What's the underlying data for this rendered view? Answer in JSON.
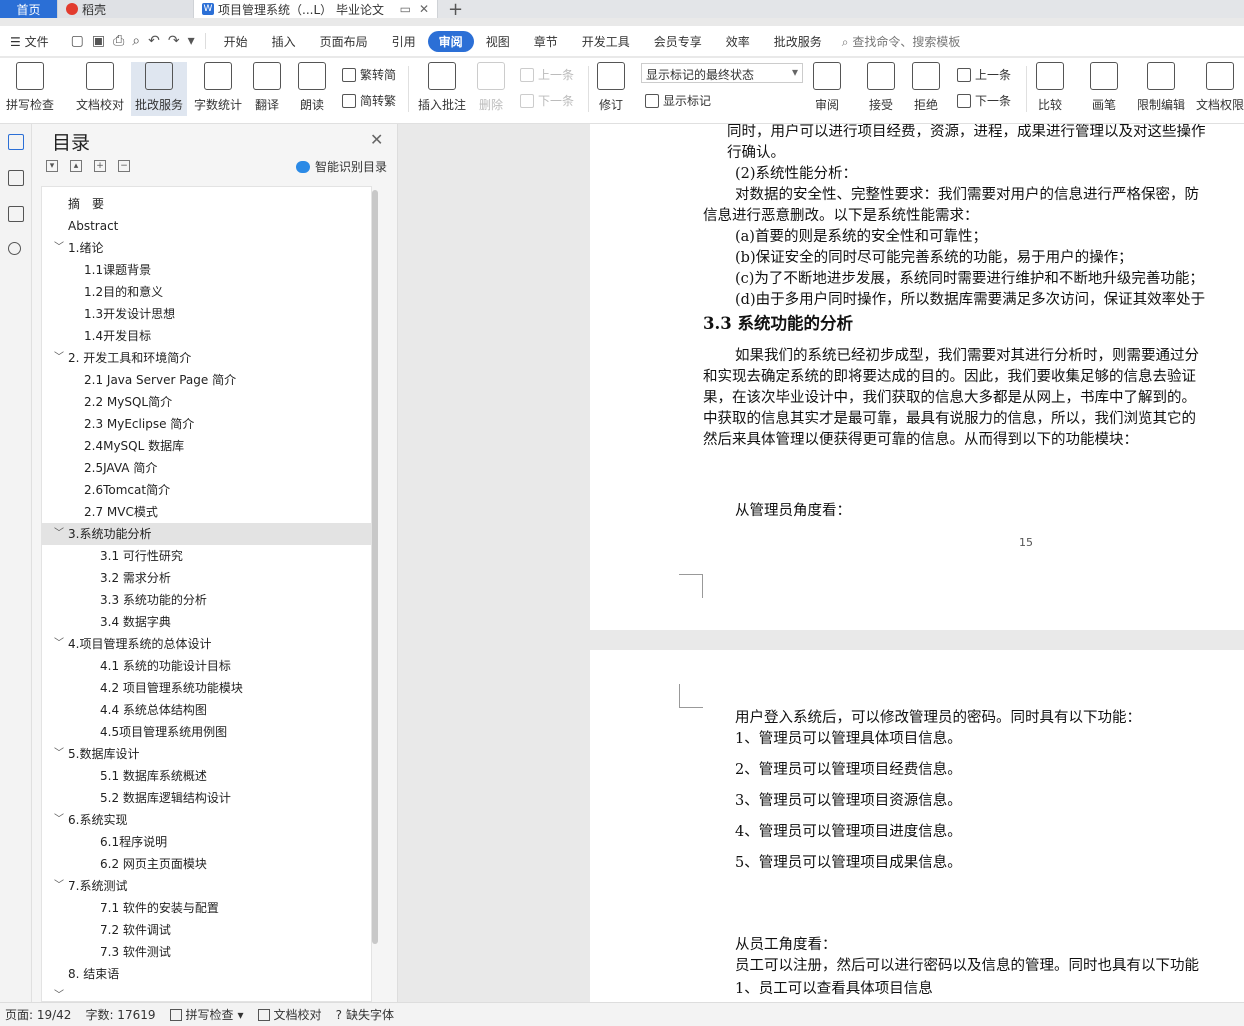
{
  "tabs": {
    "home": "首页",
    "daoke": "稻壳",
    "doc_title": "项目管理系统（...L） 毕业论文",
    "new_tab": "+"
  },
  "menu": {
    "file": "文件",
    "items": [
      "开始",
      "插入",
      "页面布局",
      "引用",
      "审阅",
      "视图",
      "章节",
      "开发工具",
      "会员专享",
      "效率",
      "批改服务"
    ],
    "active": "审阅",
    "search": "查找命令、搜索模板"
  },
  "ribbon": {
    "spell_check": "拼写检查",
    "doc_proof": "文档校对",
    "review_service": "批改服务",
    "word_count": "字数统计",
    "translate": "翻译",
    "read_aloud": "朗读",
    "trad": "繁转简",
    "simp": "简转繁",
    "insert_comment": "插入批注",
    "delete": "删除",
    "prev": "上一条",
    "next": "下一条",
    "track": "修订",
    "show_markup": "显示标记",
    "markup_dropdown": "显示标记的最终状态",
    "review": "审阅",
    "accept": "接受",
    "reject": "拒绝",
    "prev2": "上一条",
    "next2": "下一条",
    "compare": "比较",
    "pen": "画笔",
    "restrict": "限制编辑",
    "doc_perm": "文档权限"
  },
  "toc": {
    "title": "目录",
    "smart": "智能识别目录",
    "items": [
      {
        "label": "摘　要",
        "level": 1,
        "chev": false
      },
      {
        "label": "Abstract",
        "level": 1,
        "chev": false
      },
      {
        "label": "1.绪论",
        "level": 1,
        "chev": true
      },
      {
        "label": "1.1课题背景",
        "level": 2,
        "chev": false
      },
      {
        "label": "1.2目的和意义",
        "level": 2,
        "chev": false
      },
      {
        "label": "1.3开发设计思想",
        "level": 2,
        "chev": false
      },
      {
        "label": "1.4开发目标",
        "level": 2,
        "chev": false
      },
      {
        "label": "2. 开发工具和环境简介",
        "level": 1,
        "chev": true
      },
      {
        "label": "2.1 Java Server Page  简介",
        "level": 2,
        "chev": false
      },
      {
        "label": "2.2 MySQL简介",
        "level": 2,
        "chev": false
      },
      {
        "label": "2.3 MyEclipse  简介",
        "level": 2,
        "chev": false
      },
      {
        "label": "2.4MySQL 数据库",
        "level": 2,
        "chev": false
      },
      {
        "label": "2.5JAVA  简介",
        "level": 2,
        "chev": false
      },
      {
        "label": "2.6Tomcat简介",
        "level": 2,
        "chev": false
      },
      {
        "label": "2.7 MVC模式",
        "level": 2,
        "chev": false
      },
      {
        "label": "3.系统功能分析",
        "level": 1,
        "chev": true,
        "selected": true
      },
      {
        "label": "3.1  可行性研究",
        "level": 3,
        "chev": false
      },
      {
        "label": "3.2  需求分析",
        "level": 3,
        "chev": false
      },
      {
        "label": "3.3  系统功能的分析",
        "level": 3,
        "chev": false
      },
      {
        "label": "3.4  数据字典",
        "level": 3,
        "chev": false
      },
      {
        "label": "4.项目管理系统的总体设计",
        "level": 1,
        "chev": true
      },
      {
        "label": "4.1  系统的功能设计目标",
        "level": 3,
        "chev": false
      },
      {
        "label": "4.2  项目管理系统功能模块",
        "level": 3,
        "chev": false
      },
      {
        "label": "4.4  系统总体结构图",
        "level": 3,
        "chev": false
      },
      {
        "label": "4.5项目管理系统用例图",
        "level": 3,
        "chev": false
      },
      {
        "label": "5.数据库设计",
        "level": 1,
        "chev": true
      },
      {
        "label": "5.1  数据库系统概述",
        "level": 3,
        "chev": false
      },
      {
        "label": "5.2  数据库逻辑结构设计",
        "level": 3,
        "chev": false
      },
      {
        "label": "6.系统实现",
        "level": 1,
        "chev": true
      },
      {
        "label": "6.1程序说明",
        "level": 3,
        "chev": false
      },
      {
        "label": "6.2  网页主页面模块",
        "level": 3,
        "chev": false
      },
      {
        "label": "7.系统测试",
        "level": 1,
        "chev": true
      },
      {
        "label": "7.1  软件的安装与配置",
        "level": 3,
        "chev": false
      },
      {
        "label": "7.2  软件调试",
        "level": 3,
        "chev": false
      },
      {
        "label": "7.3  软件测试",
        "level": 3,
        "chev": false
      },
      {
        "label": "8. 结束语",
        "level": 1,
        "chev": false
      },
      {
        "label": "",
        "level": 1,
        "chev": true
      }
    ]
  },
  "page1": {
    "lines": [
      "同时，用户可以进行项目经费，资源，进程，成果进行管理以及对这些操作",
      "行确认。",
      "(2)系统性能分析：",
      "对数据的安全性、完整性要求：我们需要对用户的信息进行严格保密，防",
      "信息进行恶意删改。以下是系统性能需求：",
      "(a)首要的则是系统的安全性和可靠性；",
      "(b)保证安全的同时尽可能完善系统的功能，易于用户的操作；",
      "(c)为了不断地进步发展，系统同时需要进行维护和不断地升级完善功能；",
      "(d)由于多用户同时操作，所以数据库需要满足多次访问，保证其效率处于",
      "如果我们的系统已经初步成型，我们需要对其进行分析时，则需要通过分",
      "和实现去确定系统的即将要达成的目的。因此，我们要收集足够的信息去验证",
      "果，在该次毕业设计中，我们获取的信息大多都是从网上，书库中了解到的。",
      "中获取的信息其实才是最可靠，最具有说服力的信息，所以，我们浏览其它的",
      "然后来具体管理以便获得更可靠的信息。从而得到以下的功能模块：",
      "从管理员角度看："
    ],
    "heading": "3.3  系统功能的分析",
    "page_number": "15"
  },
  "page2": {
    "lines": [
      "用户登入系统后，可以修改管理员的密码。同时具有以下功能：",
      "1、管理员可以管理具体项目信息。",
      "2、管理员可以管理项目经费信息。",
      "3、管理员可以管理项目资源信息。",
      "4、管理员可以管理项目进度信息。",
      "5、管理员可以管理项目成果信息。",
      "从员工角度看：",
      "员工可以注册，然后可以进行密码以及信息的管理。同时也具有以下功能",
      "1、员工可以查看具体项目信息"
    ]
  },
  "status": {
    "page": "页面: 19/42",
    "words": "字数: 17619",
    "spell": "拼写检查",
    "proof": "文档校对",
    "missing_font": "缺失字体"
  }
}
